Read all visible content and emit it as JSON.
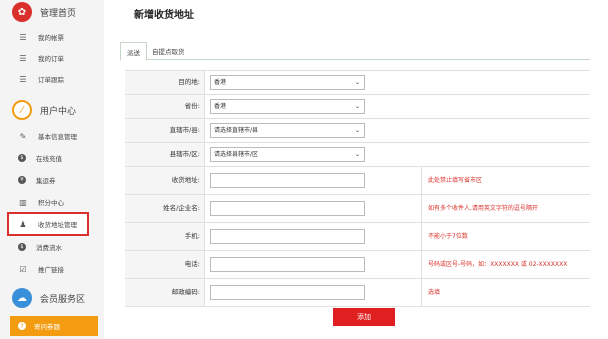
{
  "sidebar": {
    "sections": [
      {
        "label": "管理首页",
        "color": "#d9302b",
        "icon": "gear-icon"
      },
      {
        "label": "用户中心",
        "color": "#f39c12",
        "icon": "user-circle-icon"
      },
      {
        "label": "会员服务区",
        "color": "#3a8fd9",
        "icon": "handshake-icon"
      }
    ],
    "items": [
      {
        "label": "我的帐票",
        "icon": "list-icon"
      },
      {
        "label": "我的订单",
        "icon": "list-icon"
      },
      {
        "label": "订单跟踪",
        "icon": "list-icon"
      },
      {
        "label": "基本信息管理",
        "icon": "edit-icon"
      },
      {
        "label": "在线充值",
        "icon": "dollar-icon"
      },
      {
        "label": "集运券",
        "icon": "coupon-icon"
      },
      {
        "label": "积分中心",
        "icon": "points-icon"
      },
      {
        "label": "收货地址管理",
        "icon": "user-icon"
      },
      {
        "label": "消费流水",
        "icon": "dollar-icon"
      },
      {
        "label": "推广链接",
        "icon": "link-icon"
      }
    ],
    "bottom": {
      "label": "寄问券题",
      "icon": "question-icon"
    }
  },
  "page": {
    "title": "新增收货地址"
  },
  "tabs": [
    "派送",
    "自提点取货"
  ],
  "form": {
    "destination": {
      "label": "目的地:",
      "value": "香港"
    },
    "province": {
      "label": "省份:",
      "value": "香港"
    },
    "city": {
      "label": "直辖市/县:",
      "value": "请选择直辖市/县"
    },
    "district": {
      "label": "县辖市/区:",
      "value": "请选择县辖市/区"
    },
    "address": {
      "label": "收货地址:",
      "hint": "此处禁止填写省市区"
    },
    "name": {
      "label": "姓名/企业名:",
      "hint": "如有多个收件人,请用英文字符的逗号隔开"
    },
    "mobile": {
      "label": "手机:",
      "hint": "不能小于7位数"
    },
    "phone": {
      "label": "电话:",
      "hint": "号码或区号-号码，如：XXXXXXX 或 02-XXXXXXX"
    },
    "zip": {
      "label": "邮政编码:",
      "hint": "选填"
    }
  },
  "add_button": "添加",
  "colors": {
    "accent": "#e02020",
    "sidebar_active_border": "#d9302b",
    "bottom_bar": "#f39c12"
  }
}
